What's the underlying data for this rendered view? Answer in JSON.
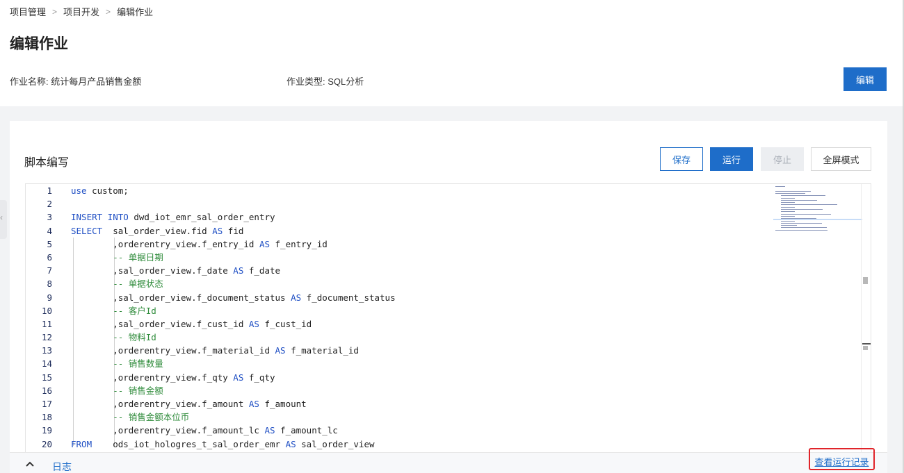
{
  "breadcrumb": [
    "项目管理",
    "项目开发",
    "编辑作业"
  ],
  "page_title": "编辑作业",
  "job_name": "作业名称: 统计每月产品销售金额",
  "job_type": "作业类型: SQL分析",
  "edit_button": "编辑",
  "script_title": "脚本编写",
  "buttons": {
    "save": "保存",
    "run": "运行",
    "stop": "停止",
    "fullscreen": "全屏模式"
  },
  "code_lines": [
    {
      "n": "1",
      "parts": [
        {
          "t": "use",
          "c": "kw"
        },
        {
          "t": " custom;",
          "c": ""
        }
      ]
    },
    {
      "n": "2",
      "parts": []
    },
    {
      "n": "3",
      "parts": [
        {
          "t": "INSERT INTO",
          "c": "kw"
        },
        {
          "t": " dwd_iot_emr_sal_order_entry",
          "c": ""
        }
      ]
    },
    {
      "n": "4",
      "parts": [
        {
          "t": "SELECT",
          "c": "kw"
        },
        {
          "t": "  sal_order_view.fid ",
          "c": ""
        },
        {
          "t": "AS",
          "c": "kw"
        },
        {
          "t": " fid",
          "c": ""
        }
      ]
    },
    {
      "n": "5",
      "parts": [
        {
          "t": "        ,orderentry_view.f_entry_id ",
          "c": ""
        },
        {
          "t": "AS",
          "c": "kw"
        },
        {
          "t": " f_entry_id",
          "c": ""
        }
      ]
    },
    {
      "n": "6",
      "parts": [
        {
          "t": "        -- 单据日期",
          "c": "cm"
        }
      ]
    },
    {
      "n": "7",
      "parts": [
        {
          "t": "        ,sal_order_view.f_date ",
          "c": ""
        },
        {
          "t": "AS",
          "c": "kw"
        },
        {
          "t": " f_date",
          "c": ""
        }
      ]
    },
    {
      "n": "8",
      "parts": [
        {
          "t": "        -- 单据状态",
          "c": "cm"
        }
      ]
    },
    {
      "n": "9",
      "parts": [
        {
          "t": "        ,sal_order_view.f_document_status ",
          "c": ""
        },
        {
          "t": "AS",
          "c": "kw"
        },
        {
          "t": " f_document_status",
          "c": ""
        }
      ]
    },
    {
      "n": "10",
      "parts": [
        {
          "t": "        -- 客户Id",
          "c": "cm"
        }
      ]
    },
    {
      "n": "11",
      "parts": [
        {
          "t": "        ,sal_order_view.f_cust_id ",
          "c": ""
        },
        {
          "t": "AS",
          "c": "kw"
        },
        {
          "t": " f_cust_id",
          "c": ""
        }
      ]
    },
    {
      "n": "12",
      "parts": [
        {
          "t": "        -- 物料Id",
          "c": "cm"
        }
      ]
    },
    {
      "n": "13",
      "parts": [
        {
          "t": "        ,orderentry_view.f_material_id ",
          "c": ""
        },
        {
          "t": "AS",
          "c": "kw"
        },
        {
          "t": " f_material_id",
          "c": ""
        }
      ]
    },
    {
      "n": "14",
      "parts": [
        {
          "t": "        -- 销售数量",
          "c": "cm"
        }
      ]
    },
    {
      "n": "15",
      "parts": [
        {
          "t": "        ,orderentry_view.f_qty ",
          "c": ""
        },
        {
          "t": "AS",
          "c": "kw"
        },
        {
          "t": " f_qty",
          "c": ""
        }
      ]
    },
    {
      "n": "16",
      "parts": [
        {
          "t": "        -- 销售金额",
          "c": "cm"
        }
      ]
    },
    {
      "n": "17",
      "parts": [
        {
          "t": "        ,orderentry_view.f_amount ",
          "c": ""
        },
        {
          "t": "AS",
          "c": "kw"
        },
        {
          "t": " f_amount",
          "c": ""
        }
      ]
    },
    {
      "n": "18",
      "parts": [
        {
          "t": "        -- 销售金额本位币",
          "c": "cm"
        }
      ]
    },
    {
      "n": "19",
      "parts": [
        {
          "t": "        ,orderentry_view.f_amount_lc ",
          "c": ""
        },
        {
          "t": "AS",
          "c": "kw"
        },
        {
          "t": " f_amount_lc",
          "c": ""
        }
      ]
    },
    {
      "n": "20",
      "parts": [
        {
          "t": "FROM",
          "c": "kw"
        },
        {
          "t": "    ods_iot_hologres_t_sal_order_emr ",
          "c": ""
        },
        {
          "t": "AS",
          "c": "kw"
        },
        {
          "t": " sal_order_view",
          "c": ""
        }
      ]
    }
  ],
  "footer": {
    "log_label": "日志",
    "run_record_link": "查看运行记录"
  },
  "colors": {
    "primary": "#1e6dc9",
    "keyword": "#1f4fc4",
    "comment": "#2e8b3a",
    "highlight_border": "#e0242a"
  },
  "icons": {
    "log_toggle": "chevron-up-icon",
    "side_collapse": "chevron-left-icon"
  }
}
